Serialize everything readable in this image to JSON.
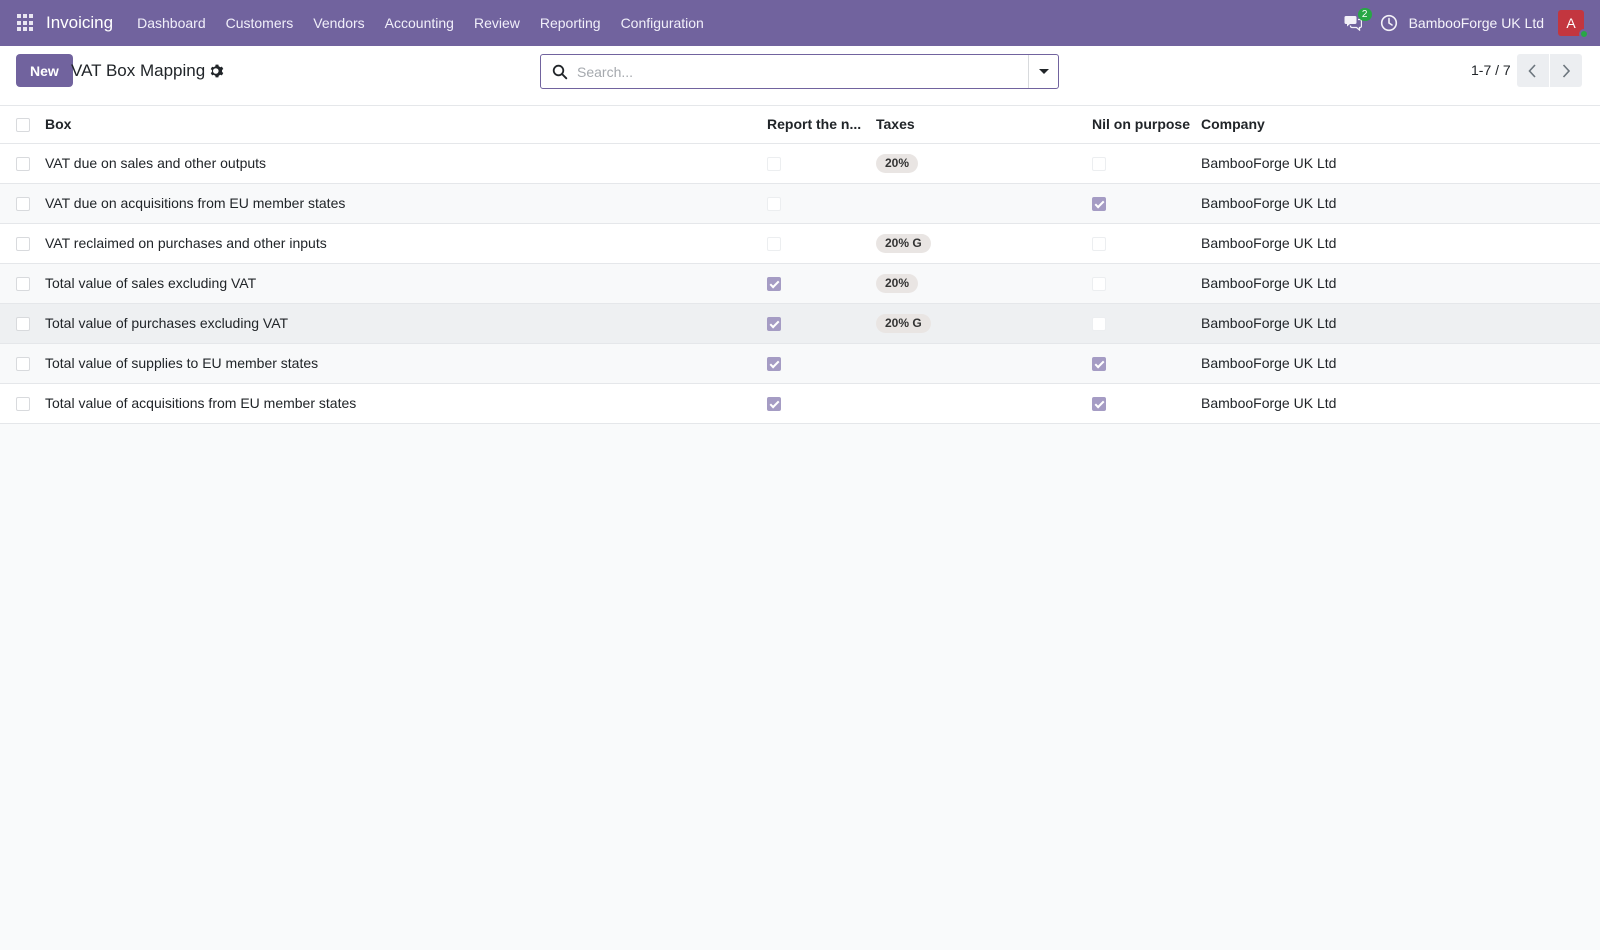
{
  "navbar": {
    "app_name": "Invoicing",
    "menu": [
      "Dashboard",
      "Customers",
      "Vendors",
      "Accounting",
      "Review",
      "Reporting",
      "Configuration"
    ],
    "chat_count": "2",
    "company": "BambooForge UK Ltd",
    "avatar_letter": "A",
    "accent_color": "#71639e"
  },
  "control_panel": {
    "new_label": "New",
    "title": "VAT Box Mapping",
    "search_placeholder": "Search...",
    "pager": "1-7 / 7"
  },
  "table": {
    "headers": {
      "box": "Box",
      "report": "Report the n...",
      "taxes": "Taxes",
      "nil": "Nil on purpose",
      "company": "Company"
    },
    "rows": [
      {
        "box": "VAT due on sales and other outputs",
        "report": false,
        "taxes": "20%",
        "nil": false,
        "company": "BambooForge UK Ltd"
      },
      {
        "box": "VAT due on acquisitions from EU member states",
        "report": false,
        "taxes": "",
        "nil": true,
        "company": "BambooForge UK Ltd"
      },
      {
        "box": "VAT reclaimed on purchases and other inputs",
        "report": false,
        "taxes": "20% G",
        "nil": false,
        "company": "BambooForge UK Ltd"
      },
      {
        "box": "Total value of sales excluding VAT",
        "report": true,
        "taxes": "20%",
        "nil": false,
        "company": "BambooForge UK Ltd"
      },
      {
        "box": "Total value of purchases excluding VAT",
        "report": true,
        "taxes": "20% G",
        "nil": false,
        "company": "BambooForge UK Ltd"
      },
      {
        "box": "Total value of supplies to EU member states",
        "report": true,
        "taxes": "",
        "nil": true,
        "company": "BambooForge UK Ltd"
      },
      {
        "box": "Total value of acquisitions from EU member states",
        "report": true,
        "taxes": "",
        "nil": true,
        "company": "BambooForge UK Ltd"
      }
    ]
  }
}
